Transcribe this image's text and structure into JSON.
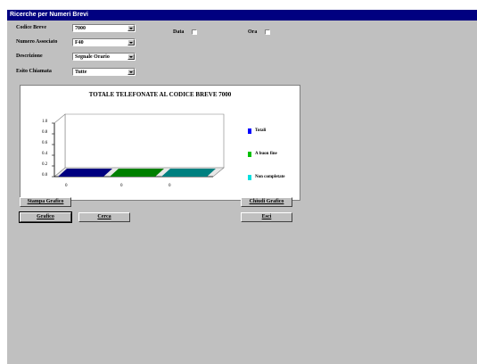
{
  "window": {
    "title": "Ricerche per Numeri Brevi"
  },
  "form": {
    "codice_breve": {
      "label": "Codice Breve",
      "value": "7000"
    },
    "numero_associato": {
      "label": "Numero Associato",
      "value": "F40"
    },
    "descrizione": {
      "label": "Descrizione",
      "value": "Segnale Orario"
    },
    "esito_chiamata": {
      "label": "Esito Chiamata",
      "value": "Tutte"
    },
    "data_label": "Data",
    "ora_label": "Ora"
  },
  "chart_data": {
    "type": "bar",
    "title": "TOTALE TELEFONATE AL CODICE BREVE 7000",
    "yticks": [
      "1.0",
      "0.8",
      "0.6",
      "0.4",
      "0.2",
      "0.0"
    ],
    "categories": [
      "0",
      "0",
      "0"
    ],
    "series": [
      {
        "name": "Totali",
        "values": [
          0
        ],
        "color": "#0000ff"
      },
      {
        "name": "A buon fine",
        "values": [
          0
        ],
        "color": "#00c000"
      },
      {
        "name": "Non completate",
        "values": [
          0
        ],
        "color": "#00e0e0"
      }
    ],
    "ylim": [
      0,
      1
    ]
  },
  "buttons": {
    "stampa_grafico": "Stampa Grafico",
    "chiudi_grafico": "Chiudi Grafico",
    "grafico": "Grafico",
    "cerca": "Cerca",
    "esci": "Esci"
  }
}
